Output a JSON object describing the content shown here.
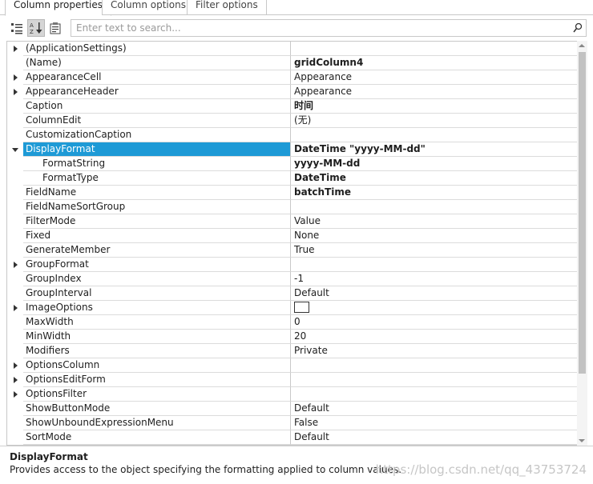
{
  "tabs": [
    {
      "label": "Column properties",
      "active": true
    },
    {
      "label": "Column options",
      "active": false
    },
    {
      "label": "Filter options",
      "active": false
    }
  ],
  "toolbar": {
    "categorized_icon": "categorized-list-icon",
    "alphabetical_icon": "sort-alphabetical-icon",
    "property_pages_icon": "property-pages-icon"
  },
  "search": {
    "placeholder": "Enter text to search...",
    "value": "",
    "icon": "search-icon"
  },
  "properties": [
    {
      "name": "(ApplicationSettings)",
      "value": "",
      "bold": false,
      "expander": "collapsed"
    },
    {
      "name": "(Name)",
      "value": "gridColumn4",
      "bold": true,
      "expander": "none"
    },
    {
      "name": "AppearanceCell",
      "value": "Appearance",
      "bold": false,
      "expander": "collapsed"
    },
    {
      "name": "AppearanceHeader",
      "value": "Appearance",
      "bold": false,
      "expander": "collapsed"
    },
    {
      "name": "Caption",
      "value": "时间",
      "bold": true,
      "expander": "none"
    },
    {
      "name": "ColumnEdit",
      "value": "(无)",
      "bold": false,
      "expander": "none"
    },
    {
      "name": "CustomizationCaption",
      "value": "",
      "bold": false,
      "expander": "none"
    },
    {
      "name": "DisplayFormat",
      "value": "DateTime \"yyyy-MM-dd\"",
      "bold": true,
      "expander": "expanded",
      "selected": true
    },
    {
      "name": "FormatString",
      "value": "yyyy-MM-dd",
      "bold": true,
      "expander": "none",
      "sub": true
    },
    {
      "name": "FormatType",
      "value": "DateTime",
      "bold": true,
      "expander": "none",
      "sub": true
    },
    {
      "name": "FieldName",
      "value": "batchTime",
      "bold": true,
      "expander": "none"
    },
    {
      "name": "FieldNameSortGroup",
      "value": "",
      "bold": false,
      "expander": "none"
    },
    {
      "name": "FilterMode",
      "value": "Value",
      "bold": false,
      "expander": "none"
    },
    {
      "name": "Fixed",
      "value": "None",
      "bold": false,
      "expander": "none"
    },
    {
      "name": "GenerateMember",
      "value": "True",
      "bold": false,
      "expander": "none"
    },
    {
      "name": "GroupFormat",
      "value": "",
      "bold": false,
      "expander": "collapsed"
    },
    {
      "name": "GroupIndex",
      "value": "-1",
      "bold": false,
      "expander": "none"
    },
    {
      "name": "GroupInterval",
      "value": "Default",
      "bold": false,
      "expander": "none"
    },
    {
      "name": "ImageOptions",
      "value": "",
      "bold": false,
      "expander": "collapsed",
      "image_box": true
    },
    {
      "name": "MaxWidth",
      "value": "0",
      "bold": false,
      "expander": "none"
    },
    {
      "name": "MinWidth",
      "value": "20",
      "bold": false,
      "expander": "none"
    },
    {
      "name": "Modifiers",
      "value": "Private",
      "bold": false,
      "expander": "none"
    },
    {
      "name": "OptionsColumn",
      "value": "",
      "bold": false,
      "expander": "collapsed"
    },
    {
      "name": "OptionsEditForm",
      "value": "",
      "bold": false,
      "expander": "collapsed"
    },
    {
      "name": "OptionsFilter",
      "value": "",
      "bold": false,
      "expander": "collapsed"
    },
    {
      "name": "ShowButtonMode",
      "value": "Default",
      "bold": false,
      "expander": "none"
    },
    {
      "name": "ShowUnboundExpressionMenu",
      "value": "False",
      "bold": false,
      "expander": "none"
    },
    {
      "name": "SortMode",
      "value": "Default",
      "bold": false,
      "expander": "none"
    }
  ],
  "description": {
    "title": "DisplayFormat",
    "text": "Provides access to the object specifying the formatting applied to column values."
  },
  "watermark": "https://blog.csdn.net/qq_43753724",
  "colors": {
    "selection": "#1e9ad6",
    "grid_line": "#dcdcdc",
    "border": "#c8c8c8"
  }
}
